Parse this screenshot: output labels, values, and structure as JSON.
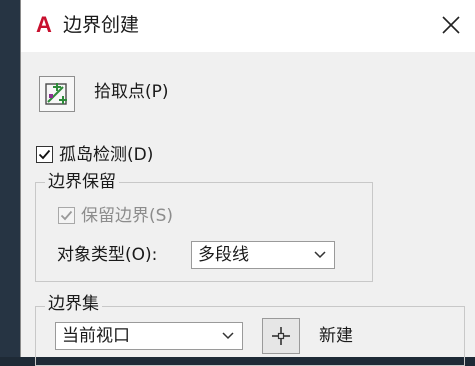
{
  "window": {
    "title": "边界创建",
    "logo_icon": "autocad-logo-icon",
    "close_icon": "close-icon"
  },
  "pick_points": {
    "icon": "pick-points-icon",
    "label": "拾取点(P)"
  },
  "island_detection": {
    "checked": true,
    "label": "孤岛检测(D)"
  },
  "boundary_retention": {
    "group_title": "边界保留",
    "retain_checkbox": {
      "checked": true,
      "enabled": false,
      "label": "保留边界(S)"
    },
    "object_type": {
      "label": "对象类型(O):",
      "value": "多段线"
    }
  },
  "boundary_set": {
    "group_title": "边界集",
    "selection": {
      "value": "当前视口"
    },
    "new_button_icon": "crosshair-select-icon",
    "new_label": "新建"
  },
  "colors": {
    "background_dark": "#1e2a36",
    "dialog_bg": "#f0f0f0",
    "logo_red": "#c8102e",
    "disabled_text": "#8c8c8c"
  }
}
